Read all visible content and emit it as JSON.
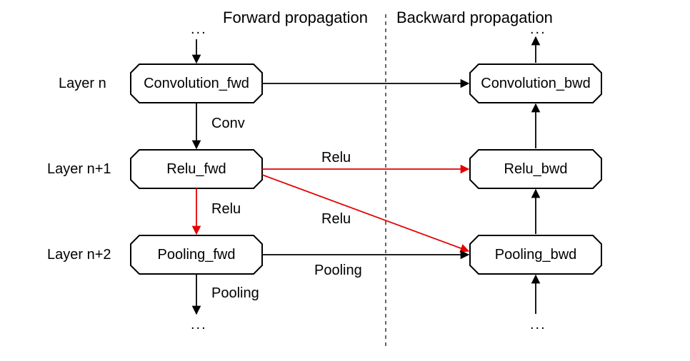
{
  "headers": {
    "forward": "Forward propagation",
    "backward": "Backward propagation"
  },
  "layers": {
    "n": "Layer n",
    "n1": "Layer n+1",
    "n2": "Layer n+2"
  },
  "boxes": {
    "conv_fwd": "Convolution_fwd",
    "relu_fwd": "Relu_fwd",
    "pool_fwd": "Pooling_fwd",
    "conv_bwd": "Convolution_bwd",
    "relu_bwd": "Relu_bwd",
    "pool_bwd": "Pooling_bwd"
  },
  "edge_labels": {
    "conv": "Conv",
    "relu1": "Relu",
    "relu2": "Relu",
    "relu3": "Relu",
    "pooling_h": "Pooling",
    "pooling_out": "Pooling"
  },
  "ellipsis": "...",
  "colors": {
    "black": "#000000",
    "red": "#e30000"
  },
  "chart_data": {
    "type": "diagram",
    "title": "Forward / Backward propagation layer flow",
    "columns": [
      "Forward propagation",
      "Backward propagation"
    ],
    "rows": [
      "Layer n",
      "Layer n+1",
      "Layer n+2"
    ],
    "nodes": [
      {
        "id": "conv_fwd",
        "label": "Convolution_fwd",
        "row": "Layer n",
        "col": "Forward propagation"
      },
      {
        "id": "relu_fwd",
        "label": "Relu_fwd",
        "row": "Layer n+1",
        "col": "Forward propagation"
      },
      {
        "id": "pool_fwd",
        "label": "Pooling_fwd",
        "row": "Layer n+2",
        "col": "Forward propagation"
      },
      {
        "id": "conv_bwd",
        "label": "Convolution_bwd",
        "row": "Layer n",
        "col": "Backward propagation"
      },
      {
        "id": "relu_bwd",
        "label": "Relu_bwd",
        "row": "Layer n+1",
        "col": "Backward propagation"
      },
      {
        "id": "pool_bwd",
        "label": "Pooling_bwd",
        "row": "Layer n+2",
        "col": "Backward propagation"
      }
    ],
    "edges": [
      {
        "from": "top_ellipsis_fwd",
        "to": "conv_fwd",
        "label": "",
        "color": "black"
      },
      {
        "from": "conv_fwd",
        "to": "relu_fwd",
        "label": "Conv",
        "color": "black"
      },
      {
        "from": "relu_fwd",
        "to": "pool_fwd",
        "label": "Relu",
        "color": "red"
      },
      {
        "from": "pool_fwd",
        "to": "bottom_ellipsis_fwd",
        "label": "Pooling",
        "color": "black"
      },
      {
        "from": "conv_fwd",
        "to": "conv_bwd",
        "label": "",
        "color": "black"
      },
      {
        "from": "relu_fwd",
        "to": "relu_bwd",
        "label": "Relu",
        "color": "red"
      },
      {
        "from": "relu_fwd",
        "to": "pool_bwd",
        "label": "Relu",
        "color": "red"
      },
      {
        "from": "pool_fwd",
        "to": "pool_bwd",
        "label": "Pooling",
        "color": "black"
      },
      {
        "from": "pool_bwd",
        "to": "relu_bwd",
        "label": "",
        "color": "black"
      },
      {
        "from": "relu_bwd",
        "to": "conv_bwd",
        "label": "",
        "color": "black"
      },
      {
        "from": "bottom_ellipsis_bwd",
        "to": "pool_bwd",
        "label": "",
        "color": "black"
      },
      {
        "from": "conv_bwd",
        "to": "top_ellipsis_bwd",
        "label": "",
        "color": "black"
      }
    ]
  }
}
